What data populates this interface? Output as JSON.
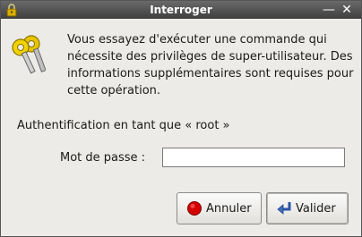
{
  "window": {
    "title": "Interroger",
    "minimize_glyph": "—",
    "close_glyph": "✕"
  },
  "message": "Vous essayez d'exécuter une commande qui nécessite des privilèges de super-utilisateur. Des informations supplémentaires sont requises pour cette opération.",
  "auth_label": "Authentification en tant que « root »",
  "password": {
    "label": "Mot de passe :",
    "value": ""
  },
  "buttons": {
    "cancel": "Annuler",
    "ok": "Valider"
  },
  "colors": {
    "titlebar": "#4a4a4a",
    "cancel_icon": "#d40000",
    "ok_icon": "#3a6fc4",
    "keys": "#d9b200"
  },
  "icons": {
    "lock": "lock-icon",
    "keys": "keys-icon",
    "cancel": "stop-icon",
    "ok": "enter-arrow-icon"
  }
}
